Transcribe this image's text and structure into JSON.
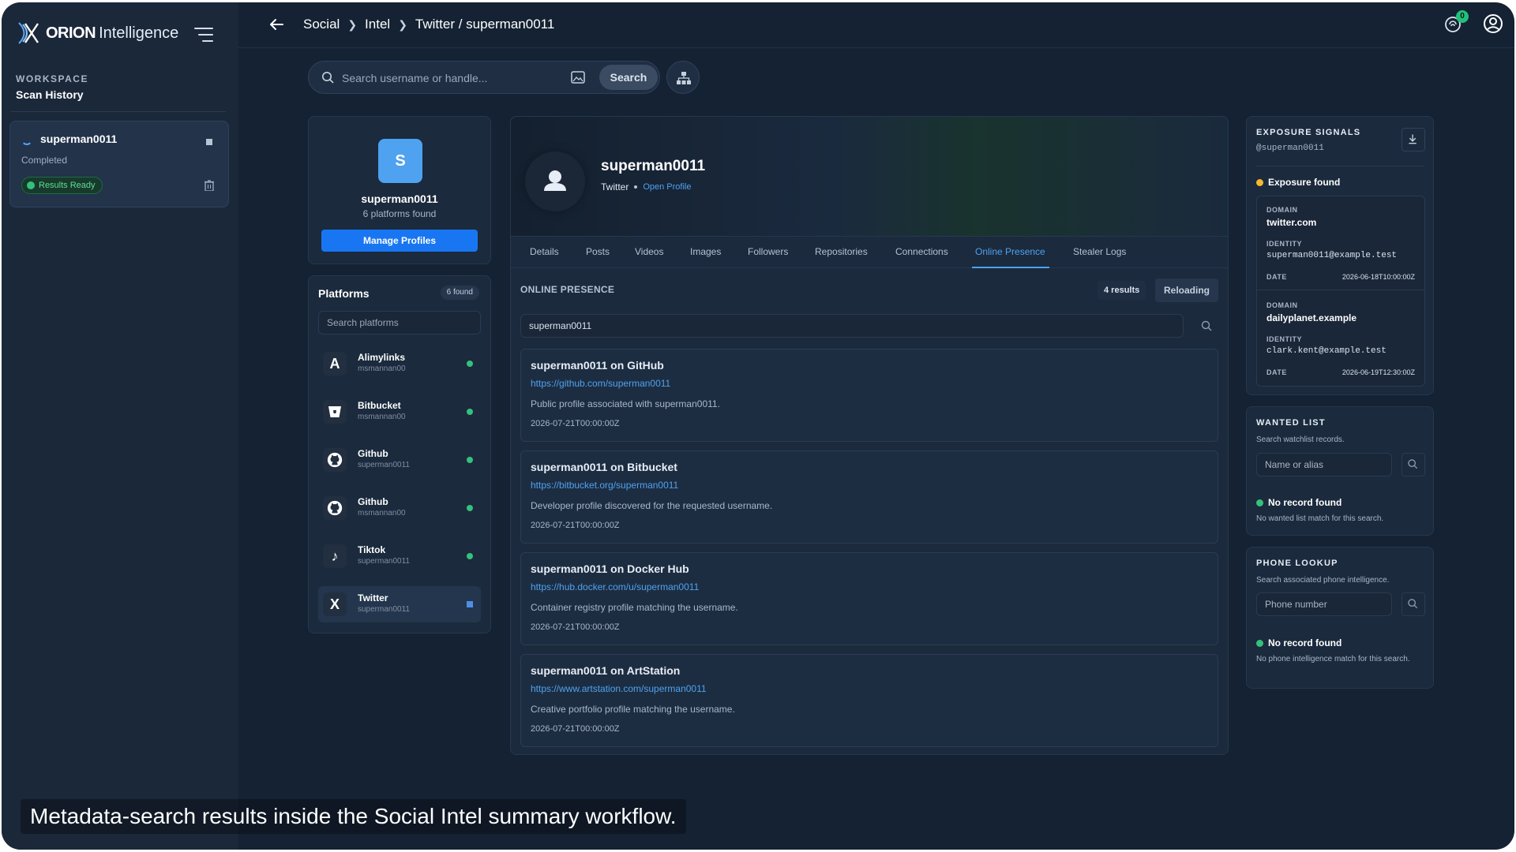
{
  "brand": {
    "name_bold": "ORION",
    "name_light": "Intelligence"
  },
  "sidebar": {
    "workspace_label": "WORKSPACE",
    "workspace_title": "Scan History",
    "scan": {
      "name": "superman0011",
      "status": "Completed",
      "badge": "Results Ready"
    }
  },
  "topbar": {
    "breadcrumbs": [
      "Social",
      "Intel",
      "Twitter / superman0011"
    ],
    "notification_count": "0"
  },
  "search": {
    "placeholder": "Search username or handle...",
    "button": "Search"
  },
  "profile": {
    "initial": "S",
    "name": "superman0011",
    "count": "6 platforms found",
    "manage": "Manage Profiles"
  },
  "platforms": {
    "title": "Platforms",
    "badge": "6 found",
    "search_placeholder": "Search platforms",
    "items": [
      {
        "name": "Alimylinks",
        "user": "msmannan00",
        "icon": "letter-a-icon",
        "glyph": "A"
      },
      {
        "name": "Bitbucket",
        "user": "msmannan00",
        "icon": "bitbucket-icon",
        "glyph": ""
      },
      {
        "name": "Github",
        "user": "superman0011",
        "icon": "github-icon",
        "glyph": ""
      },
      {
        "name": "Github",
        "user": "msmannan00",
        "icon": "github-icon",
        "glyph": ""
      },
      {
        "name": "Tiktok",
        "user": "superman0011",
        "icon": "tiktok-icon",
        "glyph": "♪"
      },
      {
        "name": "Twitter",
        "user": "superman0011",
        "icon": "x-icon",
        "glyph": "X"
      }
    ]
  },
  "hero": {
    "name": "superman0011",
    "platform": "Twitter",
    "link": "Open Profile"
  },
  "tabs": [
    "Details",
    "Posts",
    "Videos",
    "Images",
    "Followers",
    "Repositories",
    "Connections",
    "Online Presence",
    "Stealer Logs"
  ],
  "active_tab": "Online Presence",
  "online_presence": {
    "label": "ONLINE PRESENCE",
    "results": "4 results",
    "reload": "Reloading",
    "filter_value": "superman0011",
    "items": [
      {
        "title": "superman0011 on GitHub",
        "url": "https://github.com/superman0011",
        "desc": "Public profile associated with superman0011.",
        "date": "2026-07-21T00:00:00Z"
      },
      {
        "title": "superman0011 on Bitbucket",
        "url": "https://bitbucket.org/superman0011",
        "desc": "Developer profile discovered for the requested username.",
        "date": "2026-07-21T00:00:00Z"
      },
      {
        "title": "superman0011 on Docker Hub",
        "url": "https://hub.docker.com/u/superman0011",
        "desc": "Container registry profile matching the username.",
        "date": "2026-07-21T00:00:00Z"
      },
      {
        "title": "superman0011 on ArtStation",
        "url": "https://www.artstation.com/superman0011",
        "desc": "Creative portfolio profile matching the username.",
        "date": "2026-07-21T00:00:00Z"
      }
    ]
  },
  "exposure": {
    "title": "EXPOSURE SIGNALS",
    "handle": "@superman0011",
    "status": "Exposure found",
    "entries": [
      {
        "domain_label": "DOMAIN",
        "domain": "twitter.com",
        "identity_label": "IDENTITY",
        "identity": "superman0011@example.test",
        "date_label": "DATE",
        "date": "2026-06-18T10:00:00Z"
      },
      {
        "domain_label": "DOMAIN",
        "domain": "dailyplanet.example",
        "identity_label": "IDENTITY",
        "identity": "clark.kent@example.test",
        "date_label": "DATE",
        "date": "2026-06-19T12:30:00Z"
      }
    ]
  },
  "wanted": {
    "title": "WANTED LIST",
    "sub": "Search watchlist records.",
    "placeholder": "Name or alias",
    "status": "No record found",
    "status_sub": "No wanted list match for this search."
  },
  "phone": {
    "title": "PHONE LOOKUP",
    "sub": "Search associated phone intelligence.",
    "placeholder": "Phone number",
    "status": "No record found",
    "status_sub": "No phone intelligence match for this search."
  },
  "caption": "Metadata-search results inside the Social Intel summary workflow.",
  "colors": {
    "accent": "#4ea2f0",
    "primary_button": "#1976f2",
    "success": "#34c27a",
    "warning": "#f5b82e",
    "background": "#142233"
  }
}
